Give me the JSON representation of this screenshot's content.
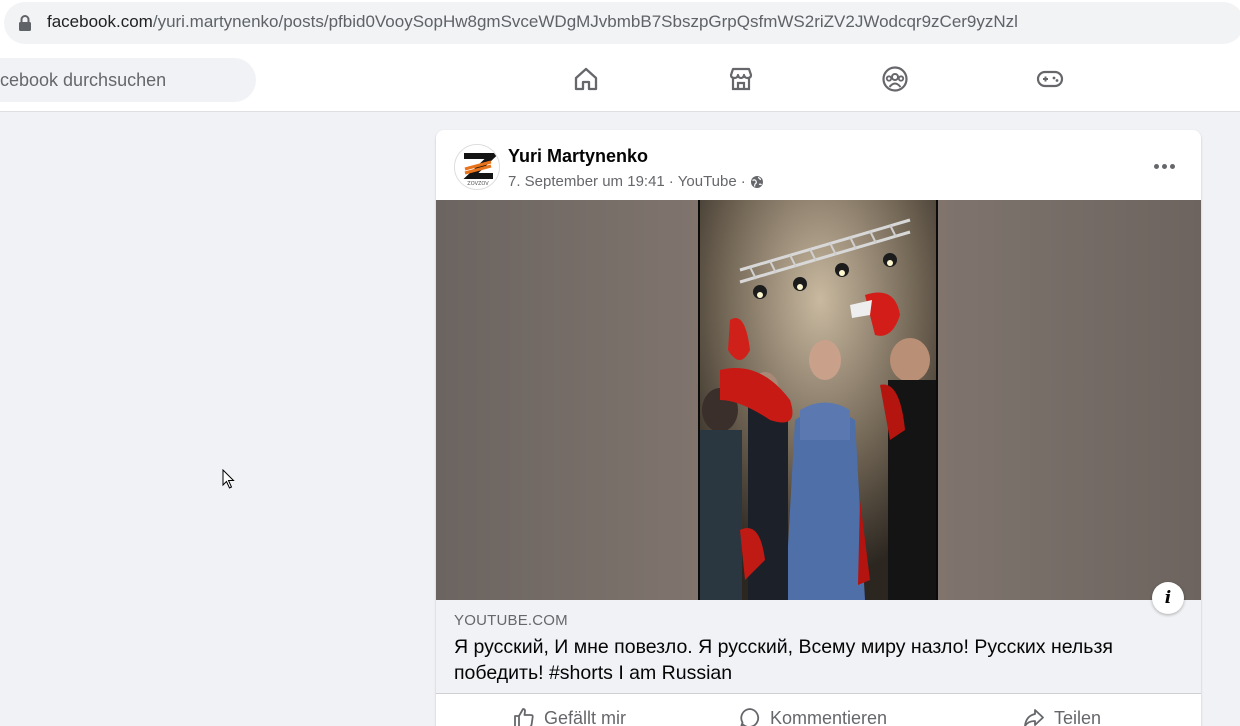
{
  "browser": {
    "url_host": "facebook.com",
    "url_path": "/yuri.martynenko/posts/pfbid0VooySopHw8gmSvceWDgMJvbmbB7SbszpGrpQsfmWS2riZV2JWodcqr9zCer9yzNzl"
  },
  "header": {
    "search_placeholder": "cebook durchsuchen",
    "nav": [
      "home-icon",
      "marketplace-icon",
      "groups-icon",
      "gaming-icon"
    ]
  },
  "post": {
    "author": "Yuri Martynenko",
    "date": "7. September um 19:41",
    "sep1": "·",
    "source": "YouTube",
    "sep2": "·",
    "privacy_icon": "globe-icon",
    "link": {
      "domain": "YOUTUBE.COM",
      "title": "Я русский, И мне повезло. Я русский, Всему миру назло! Русских нельзя победить! #shorts I am Russian"
    },
    "info_label": "i",
    "actions": {
      "like": "Gefällt mir",
      "comment": "Kommentieren",
      "share": "Teilen"
    }
  },
  "colors": {
    "fb_blue": "#1877f2",
    "secondary_text": "#65676b",
    "background": "#f0f2f5"
  }
}
